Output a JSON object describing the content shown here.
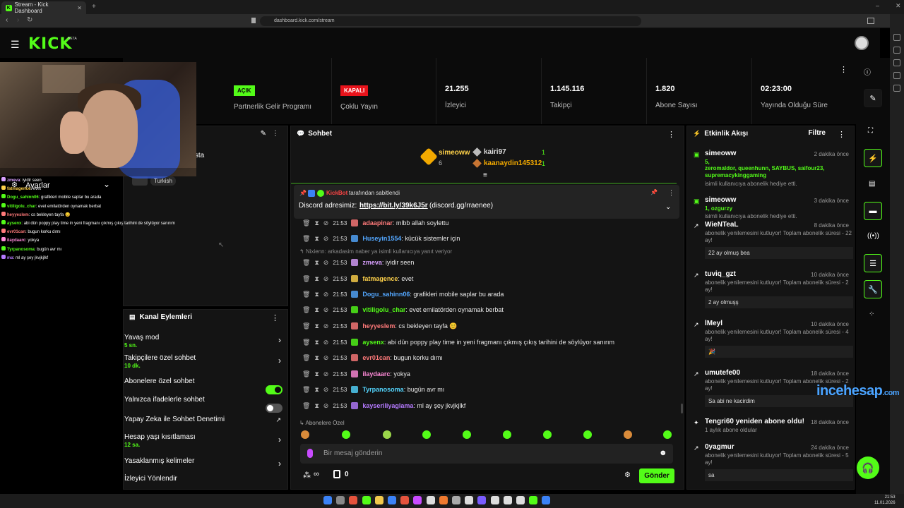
{
  "browser": {
    "tab_title": "Stream - Kick Dashboard",
    "url": "dashboard.kick.com/stream"
  },
  "header": {
    "logo": "KICK",
    "beta": "BETA"
  },
  "stats": {
    "partner_pill": "AÇIK",
    "partner_label": "Partnerlik Gelir Programı",
    "multi_pill": "KAPALI",
    "multi_label": "Çoklu Yayın",
    "viewers_value": "21.255",
    "viewers_label": "İzleyici",
    "followers_value": "1.145.116",
    "followers_label": "Takipçi",
    "subs_value": "1.820",
    "subs_label": "Abone Sayısı",
    "uptime_value": "02:23:00",
    "uptime_label": "Yayında Olduğu Süre"
  },
  "info_panel": {
    "partial_text": "n !insta",
    "tag": "Turkish",
    "settings_label": "Ayarlar"
  },
  "overlay_chat": [
    {
      "u": "zmeva",
      "m": ": iyidir seen",
      "c": "#d9a0ff"
    },
    {
      "u": "fatmagence",
      "m": ": evet",
      "c": "#ffd24a"
    },
    {
      "u": "Dogu_sahinn06",
      "m": ": grafikleri mobile saplar bu arada",
      "c": "#53fc18"
    },
    {
      "u": "vitiligolu_char",
      "m": ": evet emilatörden oynamak berbat",
      "c": "#53fc18"
    },
    {
      "u": "heyyeslem",
      "m": ": cs bekleyen tayfa 😊",
      "c": "#ff7a7a"
    },
    {
      "u": "aysenx",
      "m": ": abi dün poppy play time in yeni fragmanı çıkmış çıkış tarihini de söylüyor sanırım",
      "c": "#53fc18"
    },
    {
      "u": "evr01can",
      "m": ": bugun korku dımı",
      "c": "#ff7a7a"
    },
    {
      "u": "ilaydaarc",
      "m": ": yokya",
      "c": "#ff8ad8"
    },
    {
      "u": "Tyrpanosoma",
      "m": ": bugün avr mı",
      "c": "#53fc18"
    },
    {
      "u": "ma",
      "m": ": ml ay şey jkvjkjlkf",
      "c": "#b57aff"
    }
  ],
  "channel_actions": {
    "title": "Kanal Eylemleri",
    "slow_mode": "Yavaş mod",
    "slow_mode_val": "5 sn.",
    "followers_only": "Takipçilere özel sohbet",
    "followers_only_val": "10 dk.",
    "subs_only": "Abonelere özel sohbet",
    "emote_only": "Yalnızca ifadelerle sohbet",
    "ai_mod": "Yapay Zeka ile Sohbet Denetimi",
    "age_limit": "Hesap yaşı kısıtlaması",
    "age_limit_val": "12 sa.",
    "banned_words": "Yasaklanmış kelimeler",
    "viewer_redirect": "İzleyici Yönlendir"
  },
  "chat": {
    "title": "Sohbet",
    "top1_name": "simeoww",
    "top1_count": "6",
    "top2_name": "kairi97",
    "top2_count": "1",
    "top3_name": "kaanaydin145312",
    "top3_count": "1",
    "pinned_by": "KickBot",
    "pinned_suffix": "tarafından sabitlendi",
    "pinned_text": "Discord adresimiz:",
    "pinned_link": "https://bit.ly/39k6J5r",
    "pinned_rest": "(discord.gg/rraenee)",
    "reply_hint": "Nixienn: arkadasim naber ya isimli kullanıcıya yanıt veriyor",
    "subs_label": "Abonelere Özel",
    "input_placeholder": "Bir mesaj gönderin",
    "send_label": "Gönder",
    "points": "0",
    "messages": [
      {
        "time": "21:53",
        "user": "adaapinar",
        "text": ": mlbb allah soylettu",
        "color": "#ff7a7a"
      },
      {
        "time": "21:53",
        "user": "Huseyin1554",
        "text": ": kücük sistemler için",
        "color": "#53a7ff"
      },
      {
        "time": "21:53",
        "user": "zmeva",
        "text": ": iyidir seen",
        "color": "#d9a0ff"
      },
      {
        "time": "21:53",
        "user": "fatmagence",
        "text": ": evet",
        "color": "#ffd24a"
      },
      {
        "time": "21:53",
        "user": "Dogu_sahinn06",
        "text": ": grafikleri mobile saplar bu arada",
        "color": "#53a7ff"
      },
      {
        "time": "21:53",
        "user": "vitiligolu_char",
        "text": ": evet emilatörden oynamak berbat",
        "color": "#53fc18"
      },
      {
        "time": "21:53",
        "user": "heyyeslem",
        "text": ": cs bekleyen tayfa 😊",
        "color": "#ff7a7a"
      },
      {
        "time": "21:53",
        "user": "aysenx",
        "text": ": abi dün poppy play time in yeni fragmanı çıkmış çıkış tarihini de söylüyor sanırım",
        "color": "#53fc18"
      },
      {
        "time": "21:53",
        "user": "evr01can",
        "text": ": bugun korku dımı",
        "color": "#ff7a7a"
      },
      {
        "time": "21:53",
        "user": "ilaydaarc",
        "text": ": yokya",
        "color": "#ff8ad8"
      },
      {
        "time": "21:53",
        "user": "Tyrpanosoma",
        "text": ": bugün avr mı",
        "color": "#53d6ff"
      },
      {
        "time": "21:53",
        "user": "kayseriliyaglama",
        "text": ": ml ay şey jkvjkjlkf",
        "color": "#b57aff"
      }
    ]
  },
  "activity": {
    "title": "Etkinlik Akışı",
    "filter": "Filtre",
    "items": [
      {
        "name": "simeoww",
        "time": "2 dakika önce",
        "line1": "5,",
        "line2": "zeromaldor, queenhunn, SAYBUS, saifour23, supremacykinggaming",
        "desc": "isimli kullanıcıya abonelik hediye etti.",
        "quote": ""
      },
      {
        "name": "simeoww",
        "time": "3 dakika önce",
        "line1": "1, ozgurzy",
        "line2": "",
        "desc": "isimli kullanıcıya abonelik hediye etti.",
        "quote": ""
      },
      {
        "name": "WieNTeaL",
        "time": "8 dakika önce",
        "line1": "",
        "line2": "",
        "desc": "abonelik yenilemesini kutluyor! Toplam abonelik süresi - 22 ay!",
        "quote": "22 ay olmuş bea"
      },
      {
        "name": "tuviq_gzt",
        "time": "10 dakika önce",
        "line1": "",
        "line2": "",
        "desc": "abonelik yenilemesini kutluyor! Toplam abonelik süresi - 2 ay!",
        "quote": "2 ay olmuşş"
      },
      {
        "name": "lMeyl",
        "time": "10 dakika önce",
        "line1": "",
        "line2": "",
        "desc": "abonelik yenilemesini kutluyor! Toplam abonelik süresi - 4 ay!",
        "quote": "🎉"
      },
      {
        "name": "umutefe00",
        "time": "18 dakika önce",
        "line1": "",
        "line2": "",
        "desc": "abonelik yenilemesini kutluyor! Toplam abonelik süresi - 2 ay!",
        "quote": "Sa abi ne kacirdim"
      },
      {
        "name": "Tengri60 yeniden abone oldu!",
        "time": "18 dakika önce",
        "line1": "",
        "line2": "",
        "desc": "1 aylık abone oldular",
        "quote": ""
      },
      {
        "name": "0yagmur",
        "time": "24 dakika önce",
        "line1": "",
        "line2": "",
        "desc": "abonelik yenilemesini kutluyor! Toplam abonelik süresi - 5 ay!",
        "quote": "sa"
      }
    ]
  },
  "watermark": {
    "a": "ince",
    "b": "hesap",
    "c": ".com"
  },
  "clock": {
    "time": "21:53",
    "date": "11.01.2026"
  },
  "colors": {
    "accent": "#53fc18",
    "danger": "#e8131b",
    "bg": "#0b0b0b"
  }
}
